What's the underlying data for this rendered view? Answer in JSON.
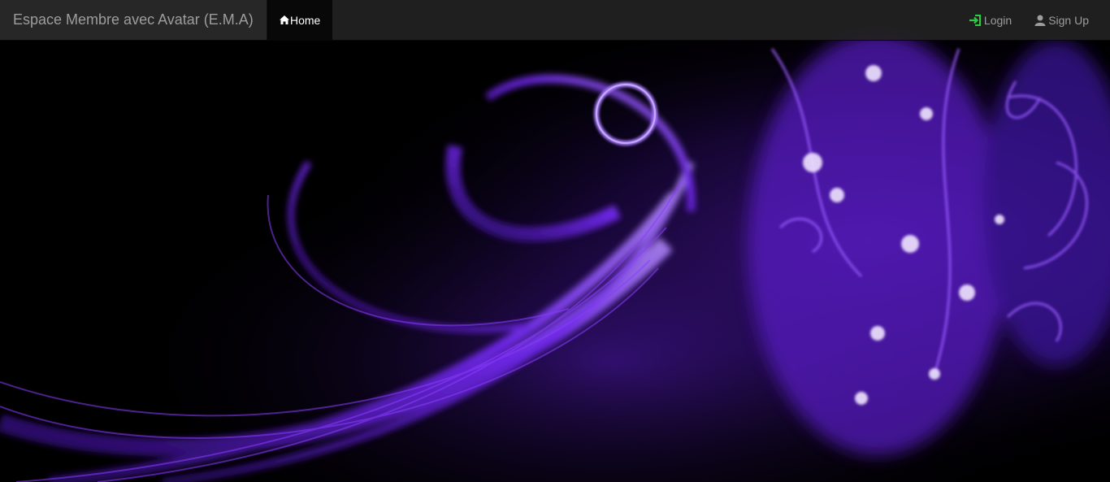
{
  "navbar": {
    "brand": "Espace Membre avec Avatar (E.M.A)",
    "home_label": "Home",
    "home_icon": "home-icon",
    "login_label": "Login",
    "login_icon": "login-icon",
    "signup_label": "Sign Up",
    "signup_icon": "user-icon"
  },
  "colors": {
    "navbar_bg": "#222222",
    "active_bg": "#080808",
    "link_text": "#9d9d9d",
    "login_icon": "#2ecc40",
    "background_accent": "#7a2cff"
  },
  "background": {
    "description_icon": "purple-swirl-wallpaper"
  }
}
